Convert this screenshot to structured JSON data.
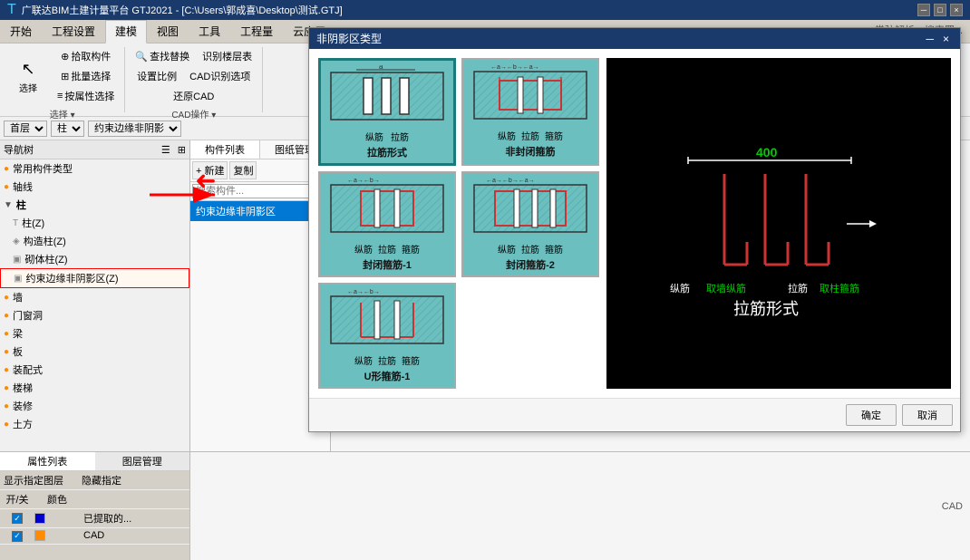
{
  "app": {
    "title": "广联达BIM土建计量平台 GTJ2021 - [C:\\Users\\郭成喜\\Desktop\\测试.GTJ]",
    "toolbar_hint": "常驻解析、搜索置..."
  },
  "ribbon": {
    "tabs": [
      "开始",
      "工程设置",
      "建模",
      "视图",
      "工具",
      "工程量",
      "云应用"
    ],
    "active_tab": "建模",
    "groups": [
      {
        "label": "选择",
        "items": [
          "选择",
          "拾取构件",
          "批量选择",
          "按属性选择"
        ]
      },
      {
        "label": "CAD操作",
        "items": [
          "查找替换",
          "设置比例",
          "识别楼层表",
          "CAD识别选项",
          "还原CAD"
        ]
      }
    ],
    "select_btn": "选择"
  },
  "toolbar_row": {
    "floor_label": "首层",
    "element_label": "柱",
    "constraint_label": "约束边缘非阴影"
  },
  "left_panel": {
    "nav_header": "导航树",
    "sections": [
      {
        "id": "common",
        "label": "常用构件类型",
        "icon": "●",
        "indent": 0
      },
      {
        "id": "axis",
        "label": "轴线",
        "icon": "●",
        "indent": 0
      },
      {
        "id": "column",
        "label": "柱",
        "icon": "▶",
        "indent": 0,
        "expanded": true
      },
      {
        "id": "col_z",
        "label": "柱(Z)",
        "icon": "T",
        "indent": 1
      },
      {
        "id": "col_gz",
        "label": "构造柱(Z)",
        "icon": "◈",
        "indent": 1
      },
      {
        "id": "col_sb",
        "label": "砌体柱(Z)",
        "icon": "▣",
        "indent": 1
      },
      {
        "id": "col_yyz",
        "label": "约束边缘非阴影区(Z)",
        "icon": "▣",
        "indent": 1,
        "selected": true,
        "highlighted": true
      },
      {
        "id": "wall",
        "label": "墙",
        "icon": "●",
        "indent": 0
      },
      {
        "id": "door",
        "label": "门窗洞",
        "icon": "●",
        "indent": 0
      },
      {
        "id": "beam",
        "label": "梁",
        "icon": "●",
        "indent": 0
      },
      {
        "id": "slab",
        "label": "板",
        "icon": "●",
        "indent": 0
      },
      {
        "id": "assembly",
        "label": "装配式",
        "icon": "●",
        "indent": 0
      },
      {
        "id": "stairs",
        "label": "楼梯",
        "icon": "●",
        "indent": 0
      },
      {
        "id": "decoration",
        "label": "装修",
        "icon": "●",
        "indent": 0
      },
      {
        "id": "earth",
        "label": "土方",
        "icon": "●",
        "indent": 0
      }
    ]
  },
  "center_panel": {
    "tabs": [
      "构件列表",
      "图纸管理"
    ],
    "active_tab": "构件列表",
    "toolbar_btns": [
      "新建",
      "复制"
    ],
    "search_placeholder": "搜索构件...",
    "items": [
      "约束边缘非阴影区"
    ]
  },
  "bottom_left_panel": {
    "tabs": [
      "属性列表",
      "图层管理"
    ],
    "active_tab": "属性列表",
    "layer_header": [
      "开/关",
      "颜色",
      ""
    ],
    "layers": [
      {
        "on": true,
        "color": "#0000ff",
        "label": "已提取的..."
      },
      {
        "on": true,
        "color": "#ff8c00",
        "label": "CAD 原..."
      }
    ]
  },
  "dialog": {
    "title": "非阴影区类型",
    "close_btn": "×",
    "min_btn": "─",
    "rebar_types": [
      {
        "id": "la_jin",
        "label": "拉筋形式",
        "selected": true,
        "sub_labels": [
          "纵筋",
          "拉筋"
        ]
      },
      {
        "id": "fei_feng_bi",
        "label": "非封闭箍筋",
        "selected": false,
        "sub_labels": [
          "纵筋",
          "拉筋",
          "箍筋"
        ]
      },
      {
        "id": "feng_bi_1",
        "label": "封闭箍筋-1",
        "selected": false,
        "sub_labels": [
          "纵筋",
          "拉筋",
          "箍筋"
        ]
      },
      {
        "id": "feng_bi_2",
        "label": "封闭箍筋-2",
        "selected": false,
        "sub_labels": [
          "纵筋",
          "拉筋",
          "箍筋"
        ]
      },
      {
        "id": "u_xing",
        "label": "U形箍筋-1",
        "selected": false,
        "sub_labels": [
          "纵筋",
          "拉筋",
          "箍筋"
        ]
      }
    ],
    "confirm_btn": "确定",
    "cancel_btn": "取消"
  },
  "large_preview": {
    "dimension": "400",
    "type_label": "拉筋形式",
    "left_label1": "纵筋",
    "left_label2": "取墙纵筋",
    "right_label1": "拉筋",
    "right_label2": "取柱箍筋"
  },
  "cad_label": "CAD"
}
